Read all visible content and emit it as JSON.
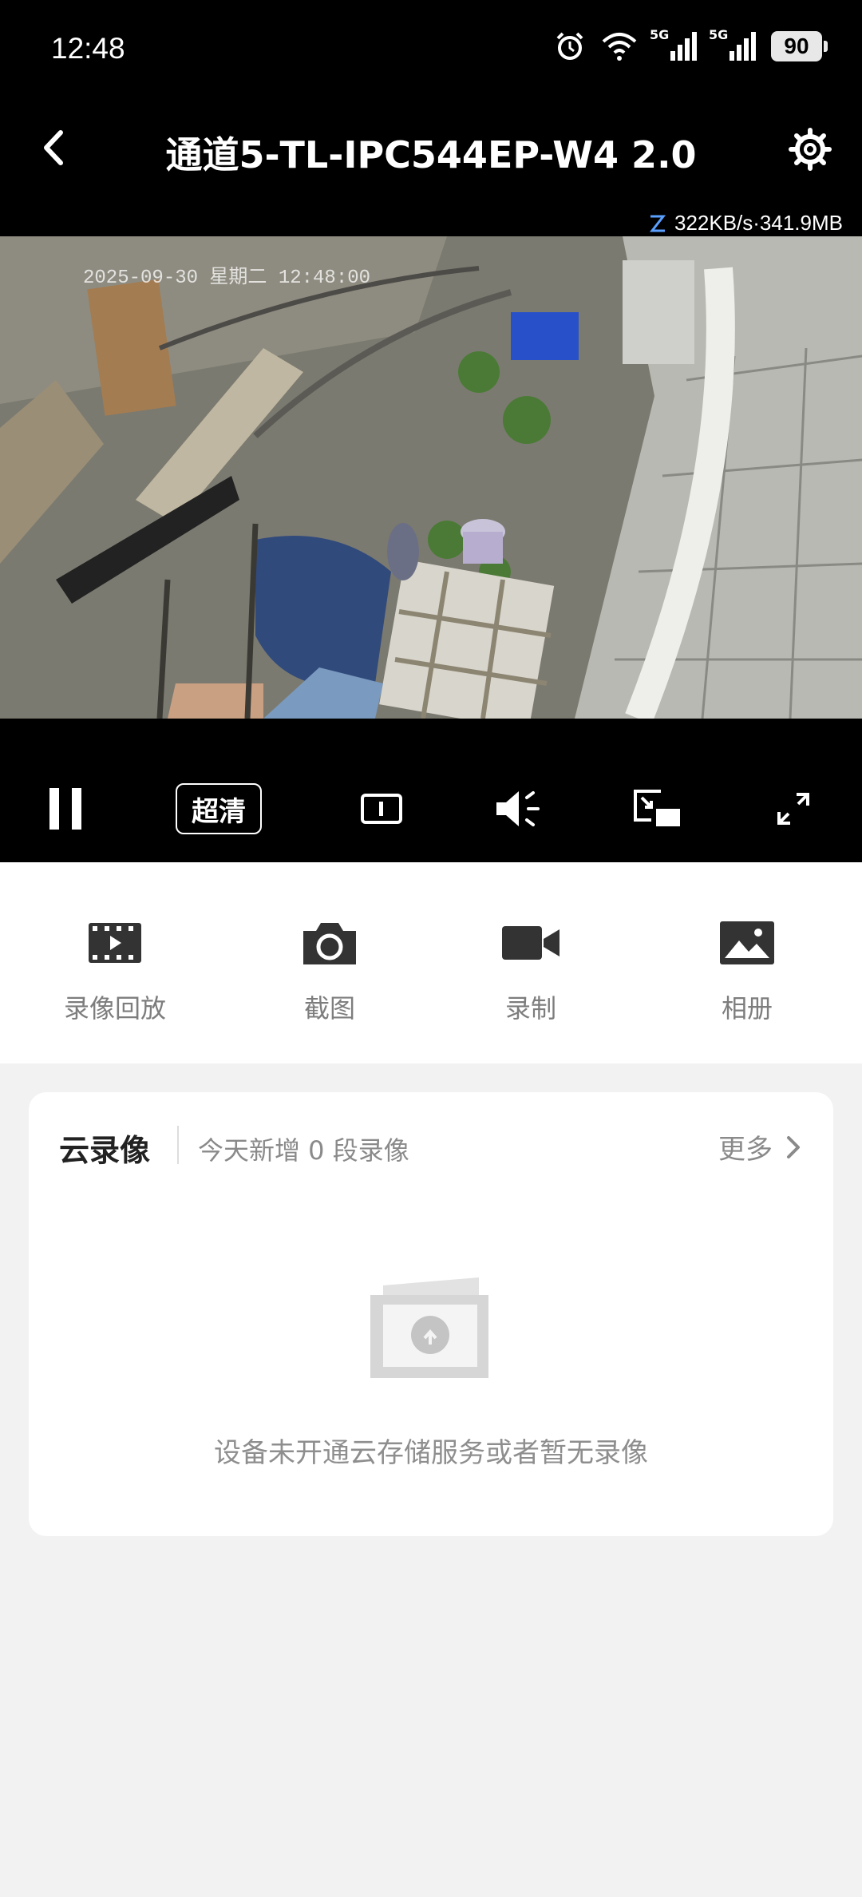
{
  "status": {
    "time": "12:48",
    "battery": "90",
    "sim1": "5G",
    "sim2": "5G"
  },
  "header": {
    "title": "通道5-TL-IPC544EP-W4 2.0"
  },
  "stream": {
    "stats": "322KB/s·341.9MB",
    "osd_timestamp": "2025-09-30 星期二 12:48:00"
  },
  "controls": {
    "quality_label": "超清"
  },
  "actions": [
    {
      "label": "录像回放",
      "icon": "film-icon"
    },
    {
      "label": "截图",
      "icon": "camera-icon"
    },
    {
      "label": "录制",
      "icon": "video-record-icon"
    },
    {
      "label": "相册",
      "icon": "album-icon"
    }
  ],
  "cloud": {
    "title": "云录像",
    "subtitle": "今天新增 0 段录像",
    "more": "更多",
    "empty_text": "设备未开通云存储服务或者暂无录像"
  }
}
